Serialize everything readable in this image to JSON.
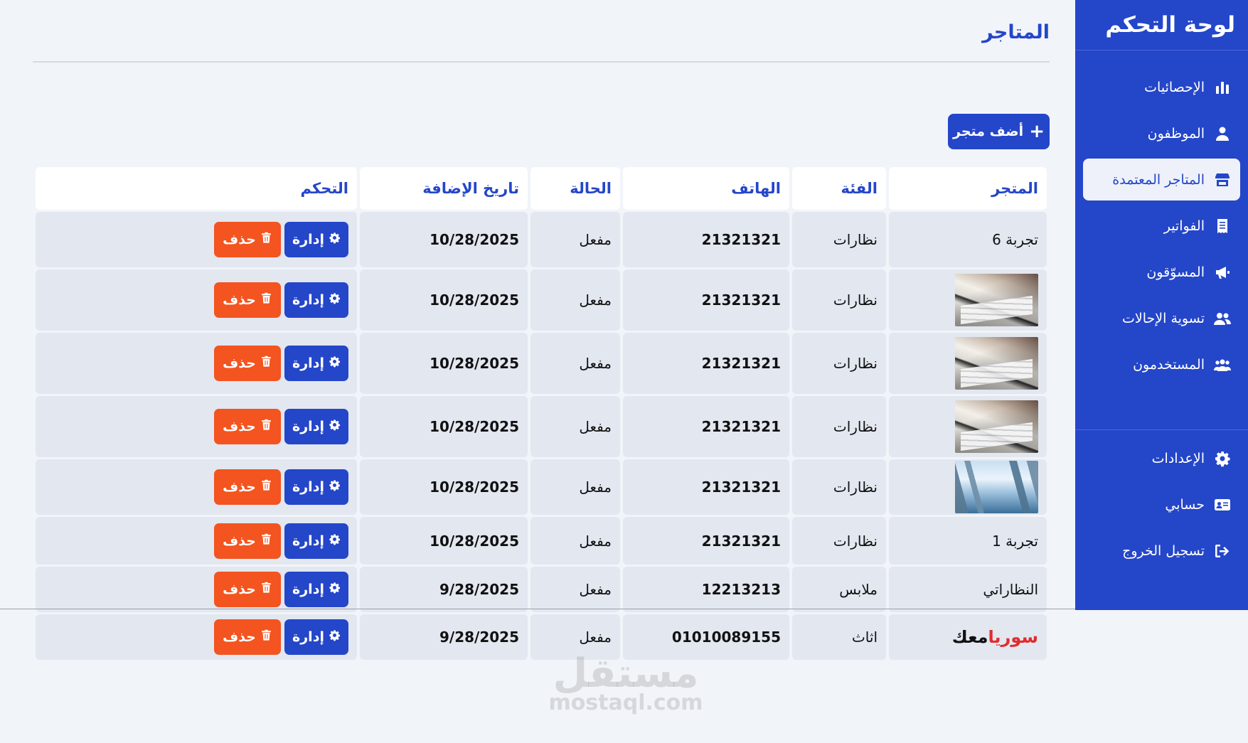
{
  "sidebar": {
    "brand": "لوحة التحكم",
    "items": [
      {
        "label": "الإحصائيات",
        "icon": "chart-bar-icon"
      },
      {
        "label": "الموظفون",
        "icon": "user-icon"
      },
      {
        "label": "المتاجر المعتمدة",
        "icon": "store-icon",
        "active": true
      },
      {
        "label": "الفواتير",
        "icon": "receipt-icon"
      },
      {
        "label": "المسوّقون",
        "icon": "megaphone-icon"
      },
      {
        "label": "تسوية الإحالات",
        "icon": "users-icon"
      },
      {
        "label": "المستخدمون",
        "icon": "users-group-icon"
      }
    ],
    "bottom_items": [
      {
        "label": "الإعدادات",
        "icon": "gear-icon"
      },
      {
        "label": "حسابي",
        "icon": "id-card-icon"
      },
      {
        "label": "تسجيل الخروج",
        "icon": "logout-icon"
      }
    ]
  },
  "main": {
    "title": "المتاجر",
    "add_button": "أضف متجر",
    "columns": [
      "المتجر",
      "الفئة",
      "الهاتف",
      "الحالة",
      "تاريخ الإضافة",
      "التحكم"
    ],
    "manage_label": "إدارة",
    "delete_label": "حذف",
    "rows": [
      {
        "store": "تجربة 6",
        "category": "نظارات",
        "phone": "21321321",
        "status": "مفعل",
        "date": "10/28/2025"
      },
      {
        "store": "",
        "category": "نظارات",
        "phone": "21321321",
        "status": "مفعل",
        "date": "10/28/2025"
      },
      {
        "store": "",
        "category": "نظارات",
        "phone": "21321321",
        "status": "مفعل",
        "date": "10/28/2025"
      },
      {
        "store": "",
        "category": "نظارات",
        "phone": "21321321",
        "status": "مفعل",
        "date": "10/28/2025"
      },
      {
        "store": "",
        "category": "نظارات",
        "phone": "21321321",
        "status": "مفعل",
        "date": "10/28/2025"
      },
      {
        "store": "تجربة 1",
        "category": "نظارات",
        "phone": "21321321",
        "status": "مفعل",
        "date": "10/28/2025"
      },
      {
        "store": "النظاراتي",
        "category": "ملابس",
        "phone": "12213213",
        "status": "مفعل",
        "date": "9/28/2025"
      },
      {
        "store": "",
        "category": "اثاث",
        "phone": "01010089155",
        "status": "مفعل",
        "date": "9/28/2025"
      }
    ],
    "row_logo": {
      "red": "سوريا",
      "dark": "معك"
    }
  },
  "watermark": {
    "arabic": "مستقل",
    "latin": "mostaql.com"
  },
  "colors": {
    "primary": "#2446c9",
    "danger": "#f4541f",
    "background": "#f1f4f9",
    "cell": "#e2e7f0"
  }
}
